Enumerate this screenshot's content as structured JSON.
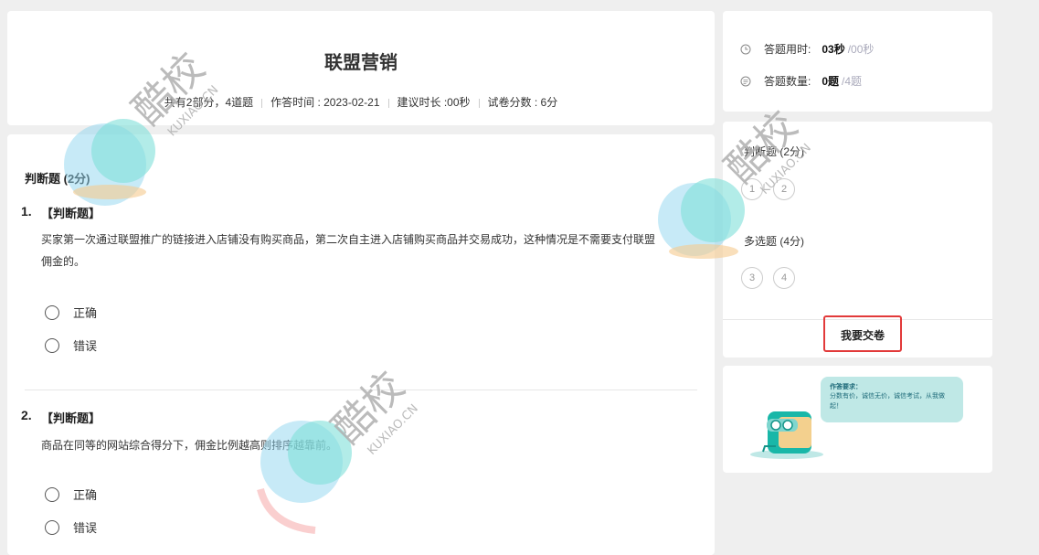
{
  "exam": {
    "title": "联盟营销",
    "meta": {
      "parts": "共有2部分，4道题",
      "answer_time": "作答时间 : 2023-02-21",
      "suggested": "建议时长 :00秒",
      "score": "试卷分数 : 6分"
    }
  },
  "section": {
    "title": "判断题 (2分)"
  },
  "questions": [
    {
      "num": "1.",
      "type": "【判断题】",
      "text_line1": "买家第一次通过联盟推广的链接进入店铺没有购买商品，第二次自主进入店铺购买商品并交易成功，这种情况是不需要支付联盟",
      "text_line2": "佣金的。",
      "options": [
        "正确",
        "错误"
      ]
    },
    {
      "num": "2.",
      "type": "【判断题】",
      "text_line1": "商品在同等的网站综合得分下，佣金比例越高则排序越靠前。",
      "options": [
        "正确",
        "错误"
      ]
    }
  ],
  "stats": {
    "time_label": "答题用时:",
    "time_value": "03秒",
    "time_total": "/00秒",
    "count_label": "答题数量:",
    "count_value": "0题",
    "count_total": "/4题"
  },
  "answer_sheet": {
    "sections": [
      {
        "label": "判断题 (2分)",
        "items": [
          "1",
          "2"
        ]
      },
      {
        "label": "多选题 (4分)",
        "items": [
          "3",
          "4"
        ]
      }
    ],
    "submit_label": "我要交卷"
  },
  "promo": {
    "title": "作答要求：",
    "text": "分数有价，诚信无价，诚信考试，从我做起！"
  },
  "watermark": {
    "brand": "酷校",
    "domain": "KUXIAO.CN"
  },
  "colors": {
    "submit_border": "#e23a3a",
    "bubble": "#bfe8e6"
  }
}
